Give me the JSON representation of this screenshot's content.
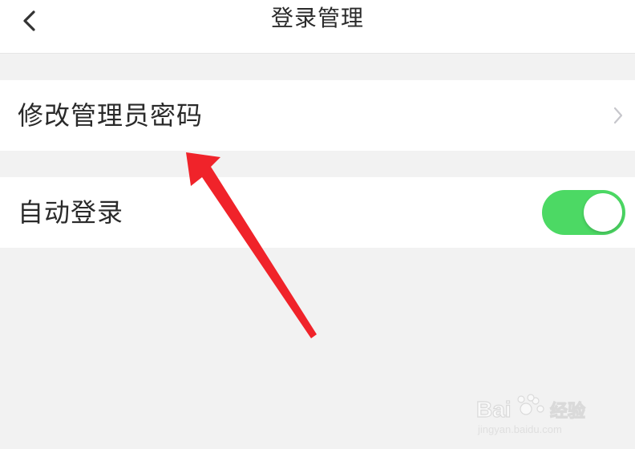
{
  "header": {
    "title": "登录管理",
    "back_icon": "chevron-left-icon"
  },
  "settings": {
    "change_password": {
      "label": "修改管理员密码",
      "icon": "chevron-right-icon"
    },
    "auto_login": {
      "label": "自动登录",
      "enabled": true
    }
  },
  "colors": {
    "toggle_on": "#4cd964",
    "arrow": "#f0232a",
    "background": "#f2f2f2",
    "chevron": "#c7c7cc"
  },
  "watermark": {
    "brand": "Baidu经验",
    "url": "jingyan.baidu.com"
  }
}
